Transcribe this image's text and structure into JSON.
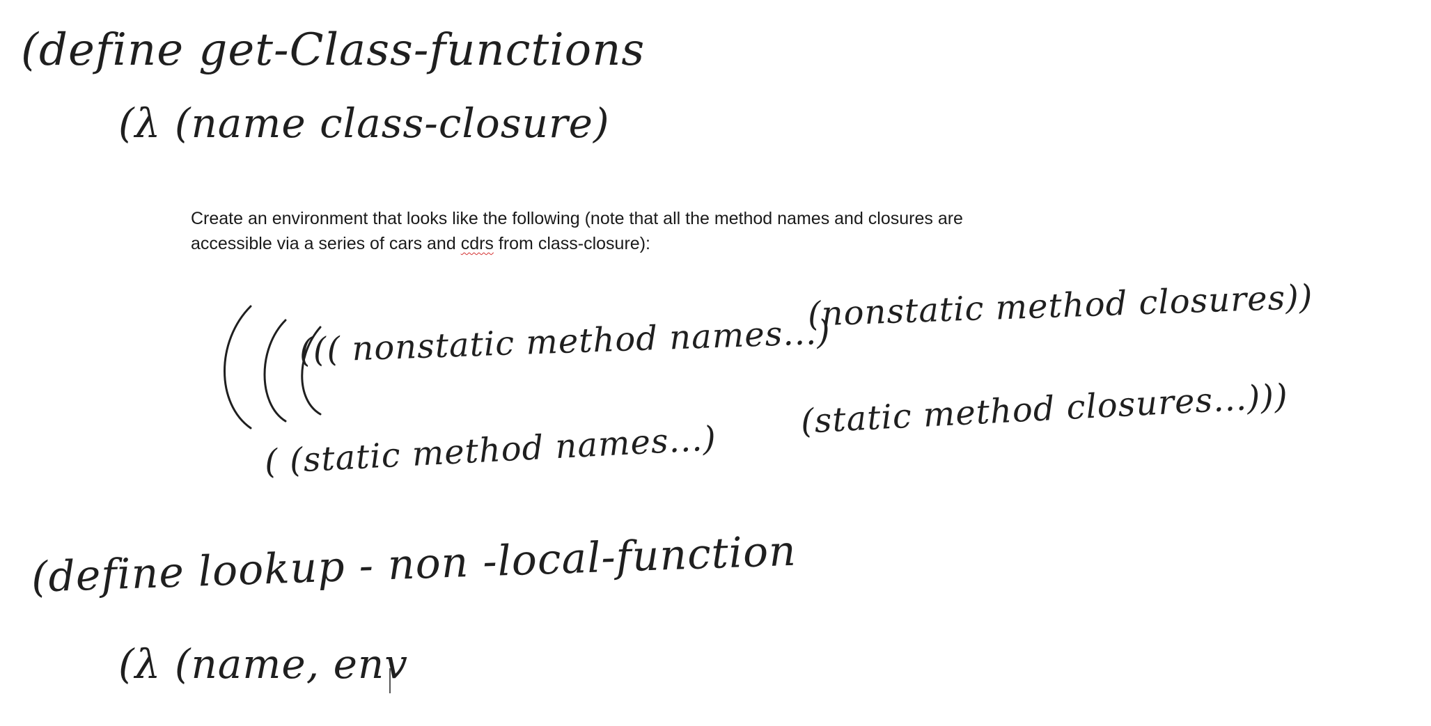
{
  "handwritten": {
    "define_get_class_functions": "(define   get-Class-functions",
    "lambda_name_class_closure": "(λ (name       class-closure)",
    "env_nonstatic_names": "((( nonstatic method names...)",
    "env_nonstatic_closures": "(nonstatic method closures))",
    "env_static_names": "( (static method names...)",
    "env_static_closures": "(static method closures...)))",
    "define_lookup_non_local_function": "(define  lookup - non -local-function",
    "lambda_name_env": "(λ  (name,   env"
  },
  "instruction": {
    "line1": "Create an environment that looks like the following (note that all the method names and closures are",
    "line2_before": "accessible via a series of cars and ",
    "line2_misspelled": "cdrs",
    "line2_after": " from class-closure):"
  }
}
